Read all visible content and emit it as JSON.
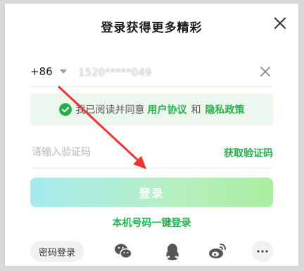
{
  "dialog": {
    "title": "登录获得更多精彩"
  },
  "phone": {
    "country_code": "+86",
    "value": "1520*****049"
  },
  "agreement": {
    "prefix": "我已阅读并同意",
    "user_agreement": "用户协议",
    "and": "和",
    "privacy_policy": "隐私政策",
    "checked": true
  },
  "code": {
    "placeholder": "请输入验证码",
    "get_code_label": "获取验证码"
  },
  "login_button": "登录",
  "one_key_login": "本机号码一键登录",
  "bottom": {
    "password_login": "密码登录",
    "social_icons": [
      "wechat-icon",
      "qq-icon",
      "weibo-icon"
    ],
    "more_icon": "more-icon"
  },
  "colors": {
    "accent": "#22b14c",
    "annotation_arrow": "#e8382d"
  }
}
